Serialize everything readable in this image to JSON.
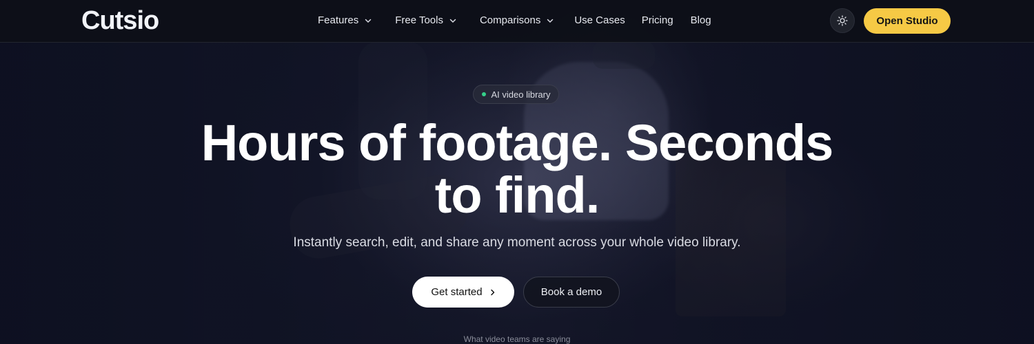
{
  "brand": {
    "logo": "Cutsio"
  },
  "nav": {
    "items": [
      {
        "label": "Features",
        "has_dropdown": true
      },
      {
        "label": "Free Tools",
        "has_dropdown": true
      },
      {
        "label": "Comparisons",
        "has_dropdown": true
      },
      {
        "label": "Use Cases",
        "has_dropdown": false
      },
      {
        "label": "Pricing",
        "has_dropdown": false
      },
      {
        "label": "Blog",
        "has_dropdown": false
      }
    ],
    "theme_toggle_icon": "sun-icon",
    "cta_label": "Open Studio"
  },
  "hero": {
    "badge": "AI video library",
    "headline_line1": "Hours of footage. Seconds",
    "headline_line2": "to find.",
    "subheadline": "Instantly search, edit, and share any moment across your whole video library.",
    "primary_cta": "Get started",
    "secondary_cta": "Book a demo",
    "testimonials_label": "What video teams are saying"
  },
  "colors": {
    "accent": "#f6c945",
    "badge_dot": "#35d08a",
    "background": "#0d1020"
  }
}
